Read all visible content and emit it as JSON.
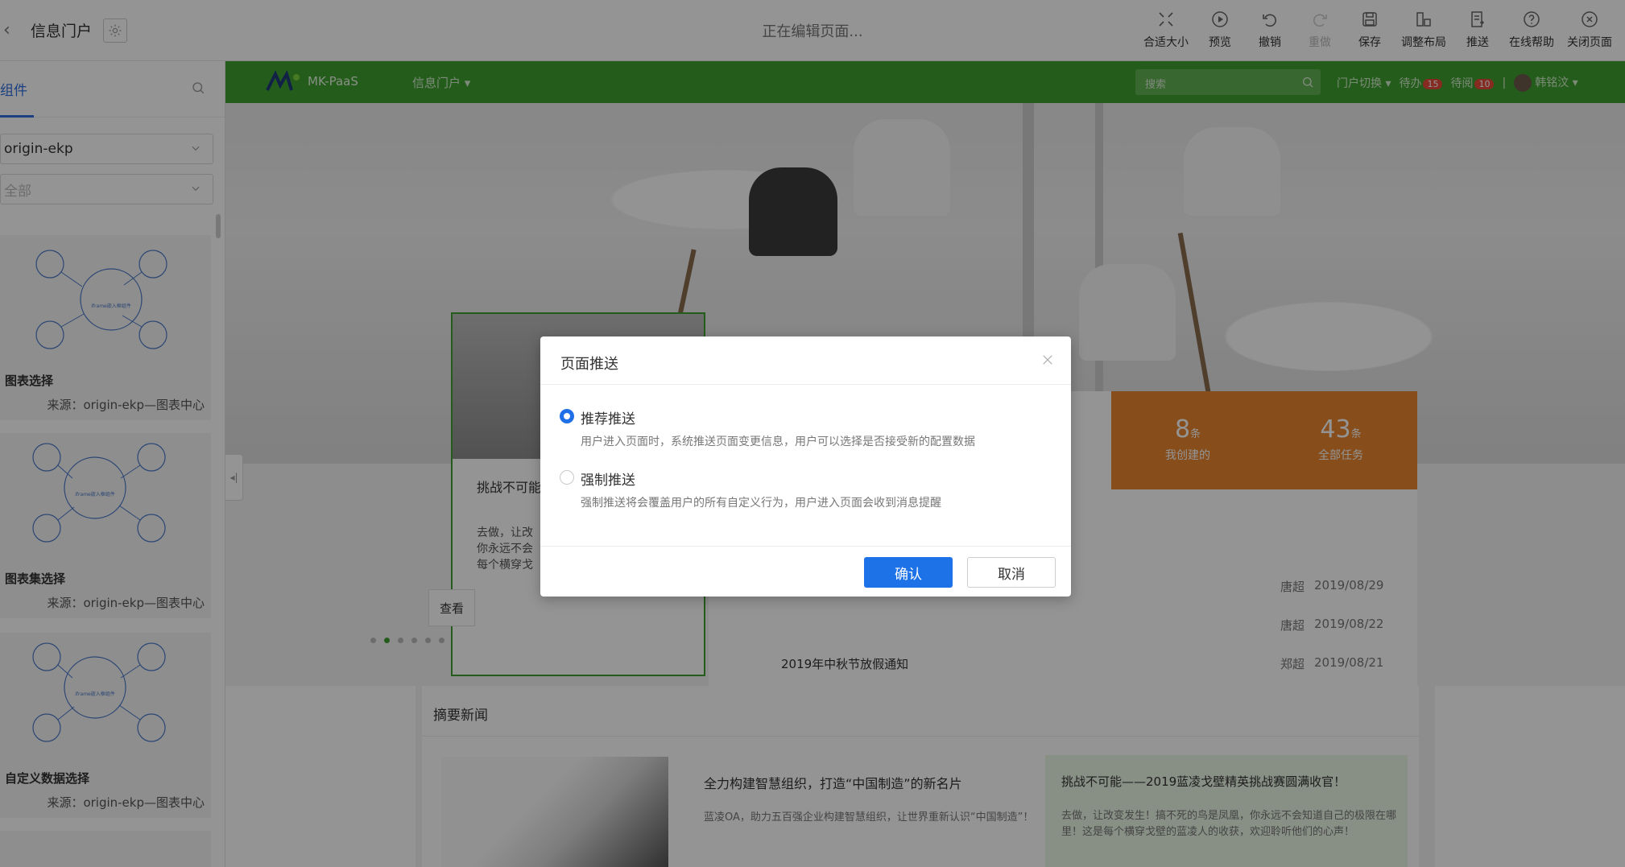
{
  "topbar": {
    "portal_title": "信息门户",
    "editing_status": "正在编辑页面...",
    "tools": [
      "合适大小",
      "预览",
      "撤销",
      "重做",
      "保存",
      "调整布局",
      "推送",
      "在线帮助",
      "关闭页面"
    ]
  },
  "left_panel": {
    "tab": "组件",
    "source_select": "origin-ekp",
    "category_select": "全部",
    "thumb_text": "iframe嵌入框组件",
    "cards": [
      {
        "title": "图表选择",
        "source": "来源：origin-ekp—图表中心"
      },
      {
        "title": "图表集选择",
        "source": "来源：origin-ekp—图表中心"
      },
      {
        "title": "自定义数据选择",
        "source": "来源：origin-ekp—图表中心"
      }
    ]
  },
  "canvas": {
    "brand": "MK-PaaS",
    "portal_menu": "信息门户 ▾",
    "search_placeholder": "搜索",
    "portal_switch": "门户切换 ▾",
    "todo_label": "待办",
    "todo_count": "15",
    "toread_label": "待阅",
    "toread_count": "10",
    "user": "韩铭汶 ▾",
    "carousel_title": "挑战不可能",
    "carousel_body": "去做，让改\n你永远不会\n每个横穿戈",
    "view_button": "查看",
    "stats": [
      {
        "num": "8",
        "unit": "条",
        "caption": "我创建的"
      },
      {
        "num": "43",
        "unit": "条",
        "caption": "全部任务"
      }
    ],
    "task_rows": [
      {
        "title": "",
        "who": "唐超",
        "date": "2019/08/29"
      },
      {
        "title": "",
        "who": "唐超",
        "date": "2019/08/22"
      },
      {
        "title": "2019年中秋节放假通知",
        "who": "郑超",
        "date": "2019/08/21"
      }
    ],
    "news_header": "摘要新闻",
    "news_title": "全力构建智慧组织，打造“中国制造”的新名片",
    "news_desc": "蓝凌OA，助力五百强企业构建智慧组织，让世界重新认识“中国制造”！",
    "news_card_title": "挑战不可能——2019蓝凌戈壁精英挑战赛圆满收官！",
    "news_card_desc": "去做，让改变发生！搞不死的鸟是凤凰，你永远不会知道自己的极限在哪里！这是每个横穿戈壁的蓝凌人的收获，欢迎聆听他们的心声！"
  },
  "dialog": {
    "title": "页面推送",
    "options": [
      {
        "label": "推荐推送",
        "desc": "用户进入页面时，系统推送页面变更信息，用户可以选择是否接受新的配置数据",
        "selected": true
      },
      {
        "label": "强制推送",
        "desc": "强制推送将会覆盖用户的所有自定义行为，用户进入页面会收到消息提醒",
        "selected": false
      }
    ],
    "confirm": "确认",
    "cancel": "取消"
  },
  "colors": {
    "primary": "#1e72e8",
    "nav_green": "#3fa12f",
    "stats_orange": "#e8862f"
  }
}
